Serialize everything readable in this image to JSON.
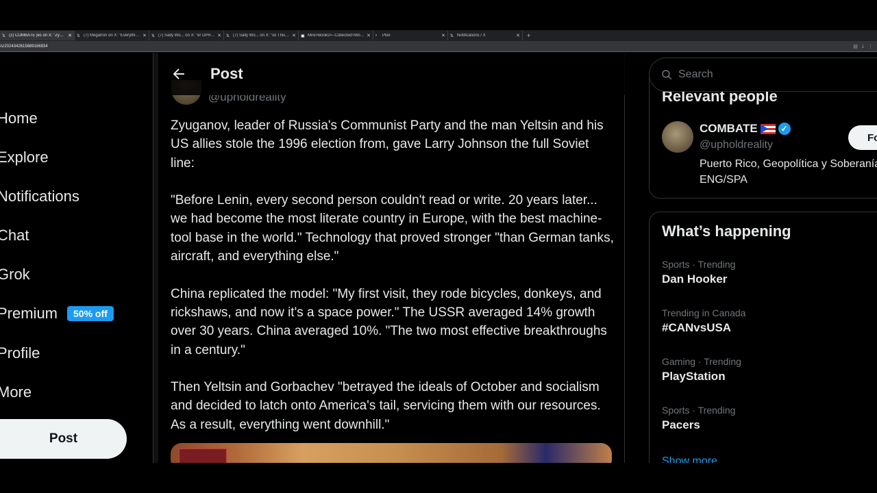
{
  "browser": {
    "tabs": [
      {
        "title": "(2) COMBATE |es on X: \"Zyuganov..."
      },
      {
        "title": "(7) Megatron on X: \"Everything is..."
      },
      {
        "title": "(7) Sally Wo... on X: \"er DPRK is..."
      },
      {
        "title": "(7) Sally Wo... on X: \"so This is th..."
      },
      {
        "title": "Mire>Books>--Collected>Works..."
      },
      {
        "title": "Plex"
      },
      {
        "title": "Notifications / X"
      }
    ],
    "url": "/s/2024342615689166934"
  },
  "nav": {
    "home": "Home",
    "explore": "Explore",
    "notifications": "Notifications",
    "chat": "Chat",
    "grok": "Grok",
    "premium": "Premium",
    "premium_badge": "50% off",
    "profile": "Profile",
    "more": "More",
    "post_button": "Post"
  },
  "header": {
    "title": "Post"
  },
  "post": {
    "handle": "@upholdreality",
    "paragraphs": [
      "Zyuganov, leader of Russia's Communist Party and the man Yeltsin and his US allies stole the 1996 election from, gave Larry Johnson the full Soviet line:",
      "\"Before Lenin, every second person couldn't read or write. 20 years later... we had become the most literate country in Europe, with the best machine-tool base in the world.\" Technology that proved stronger \"than German tanks, aircraft, and everything else.\"",
      "China replicated the model: \"My first visit, they rode bicycles, donkeys, and rickshaws, and now it's a space power.\" The USSR averaged 14% growth over 30 years. China averaged 10%. \"The two most effective breakthroughs in a century.\"",
      "Then Yeltsin and Gorbachev \"betrayed the ideals of October and socialism and decided to latch onto America's tail, servicing them with our resources. As a result, everything went downhill.\""
    ]
  },
  "search": {
    "placeholder": "Search"
  },
  "relevant": {
    "title": "Relevant people",
    "name": "COMBATE",
    "handle": "@upholdreality",
    "bio": "Puerto Rico, Geopolítica y Soberanía ENG/SPA",
    "follow_label": "Follow"
  },
  "happening": {
    "title": "What’s happening",
    "trends": [
      {
        "meta": "Sports · Trending",
        "name": "Dan Hooker"
      },
      {
        "meta": "Trending in Canada",
        "name": "#CANvsUSA"
      },
      {
        "meta": "Gaming · Trending",
        "name": "PlayStation"
      },
      {
        "meta": "Sports · Trending",
        "name": "Pacers"
      }
    ],
    "show_more": "Show more"
  },
  "colors": {
    "accent": "#1d9bf0",
    "background": "#000000",
    "text": "#e7e9ea",
    "muted": "#71767b"
  }
}
